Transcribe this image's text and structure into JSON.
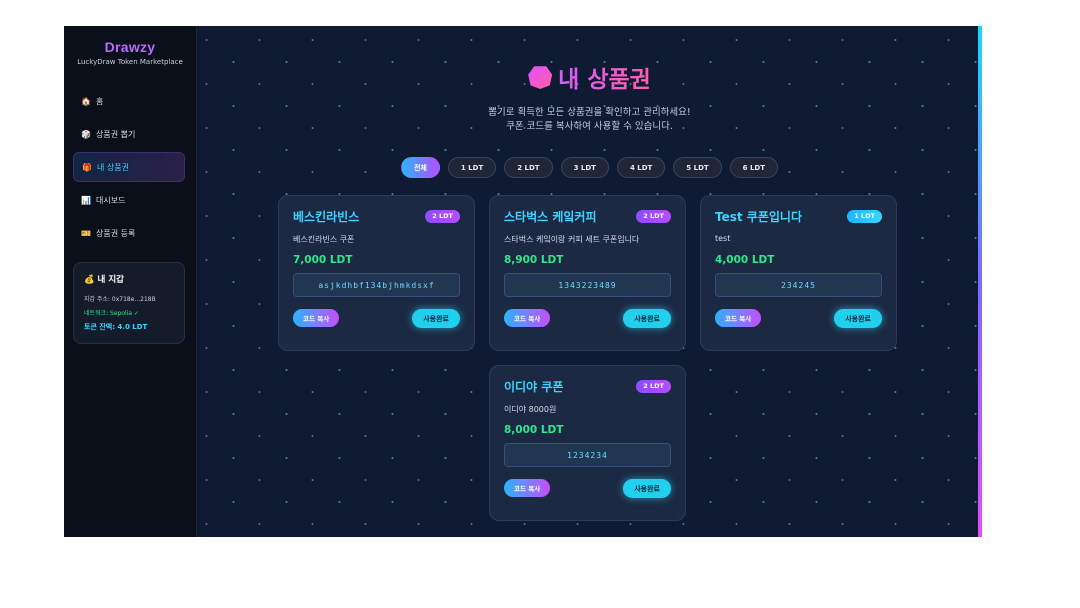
{
  "sidebar": {
    "brand": "Drawzy",
    "tagline": "LuckyDraw Token Marketplace",
    "items": [
      {
        "icon": "🏠",
        "label": "홈"
      },
      {
        "icon": "🎲",
        "label": "상품권 뽑기"
      },
      {
        "icon": "🎁",
        "label": "내 상품권"
      },
      {
        "icon": "📊",
        "label": "대시보드"
      },
      {
        "icon": "🎫",
        "label": "상품권 등록"
      }
    ],
    "active_index": 2
  },
  "wallet": {
    "title": "💰 내 지갑",
    "address": "지갑 주소: 0x718e...218B",
    "network": "네트워크: Sepolia ✓",
    "balance": "토큰 잔액: 4.0 LDT"
  },
  "page": {
    "title": "내 상품권",
    "subtitle_line1": "뽑기로 획득한 모든 상품권을 확인하고 관리하세요!",
    "subtitle_line2": "쿠폰 코드를 복사하여 사용할 수 있습니다."
  },
  "filters": [
    "전체",
    "1 LDT",
    "2 LDT",
    "3 LDT",
    "4 LDT",
    "5 LDT",
    "6 LDT"
  ],
  "active_filter": "전체",
  "cards": [
    {
      "name": "베스킨라빈스",
      "badge": "2 LDT",
      "desc": "베스킨라빈스 쿠폰",
      "price": "7,000 LDT",
      "code": "asjkdhbf134bjhmkdsxf",
      "copy": "코드 복사",
      "done": "사용완료"
    },
    {
      "name": "스타벅스 케잌커피",
      "badge": "2 LDT",
      "desc": "스타벅스 케잌이랑 커피 세트 쿠폰입니다",
      "price": "8,900 LDT",
      "code": "1343223489",
      "copy": "코드 복사",
      "done": "사용완료"
    },
    {
      "name": "Test 쿠폰입니다",
      "badge": "1 LDT",
      "desc": "test",
      "price": "4,000 LDT",
      "code": "234245",
      "copy": "코드 복사",
      "done": "사용완료"
    },
    {
      "name": "이디야 쿠폰",
      "badge": "2 LDT",
      "desc": "이디야 8000원",
      "price": "8,000 LDT",
      "code": "1234234",
      "copy": "코드 복사",
      "done": "사용완료"
    }
  ],
  "colors": {
    "accent_cyan": "#3fd3ff",
    "accent_purple": "#b76bff",
    "price_green": "#2ee88b"
  }
}
